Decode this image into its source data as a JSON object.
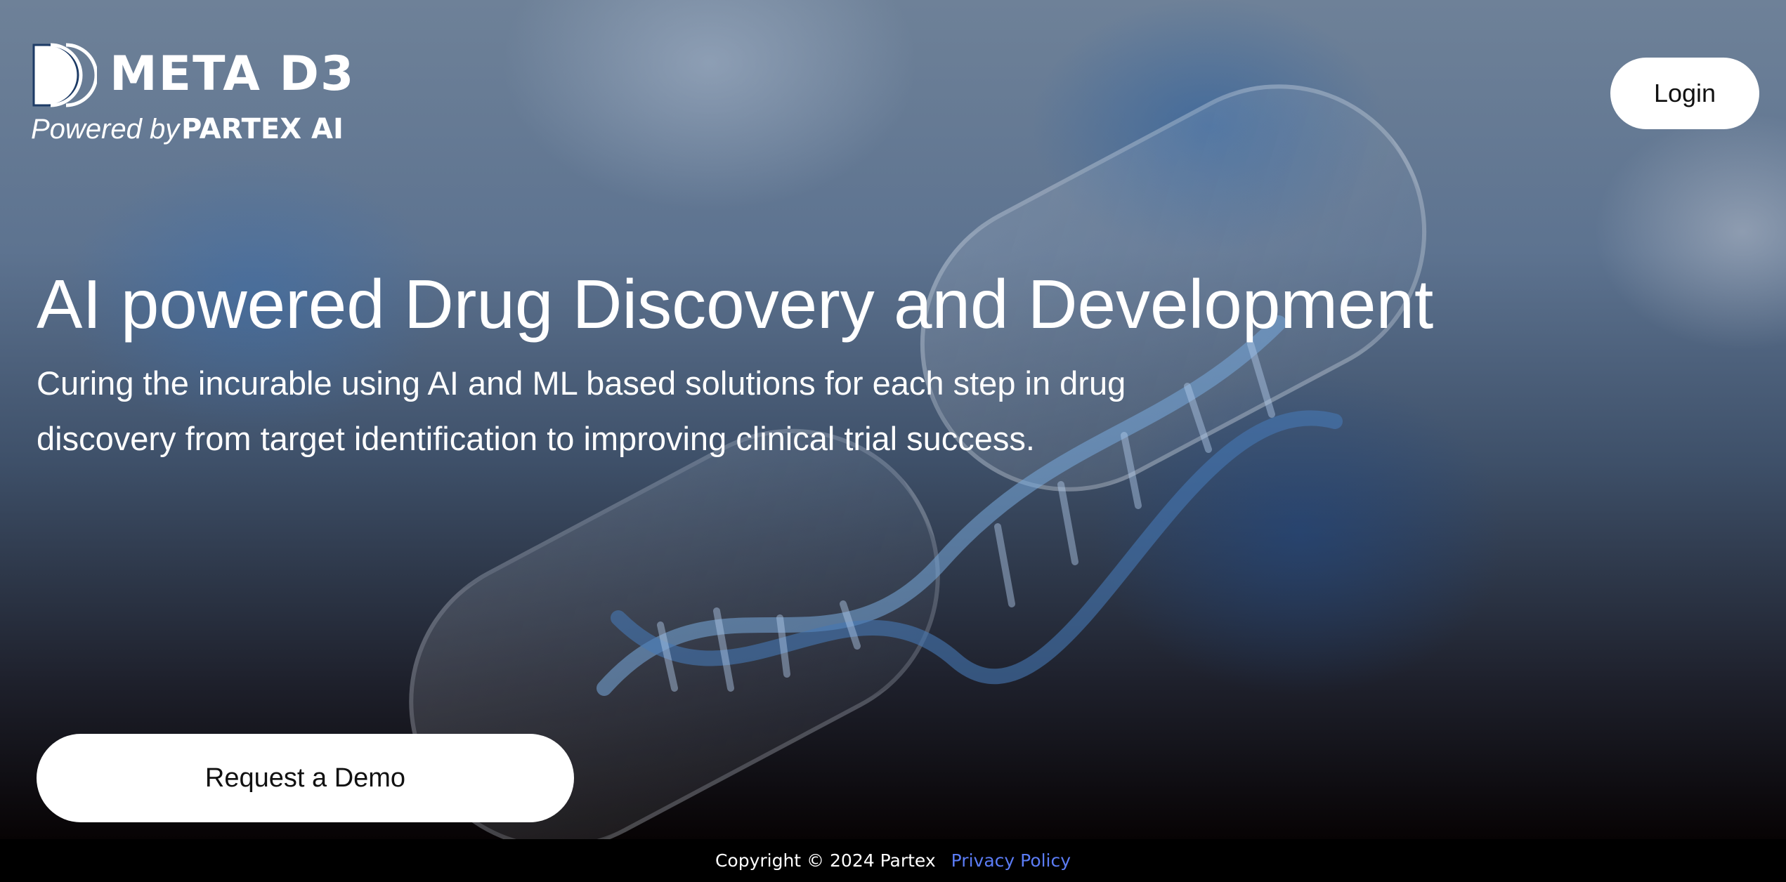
{
  "brand": {
    "name": "META D3",
    "powered_by": "Powered by",
    "company": "PARTEX AI"
  },
  "header": {
    "login_label": "Login"
  },
  "hero": {
    "headline": "AI powered Drug Discovery and Development",
    "subtext": "Curing the incurable using AI and ML based solutions for each step in drug discovery from target identification to improving clinical trial success.",
    "cta_label": "Request a Demo"
  },
  "footer": {
    "copyright": "Copyright © 2024 Partex",
    "privacy_label": "Privacy Policy"
  },
  "colors": {
    "background_top": "#6e8198",
    "background_bottom": "#070304",
    "button_bg": "#ffffff",
    "button_text": "#111111",
    "link": "#5b7cf5",
    "footer_bg": "#000000"
  },
  "icons": {
    "logo_mark": "triple-half-circle-logo-icon",
    "background": "dna-capsule-image"
  }
}
